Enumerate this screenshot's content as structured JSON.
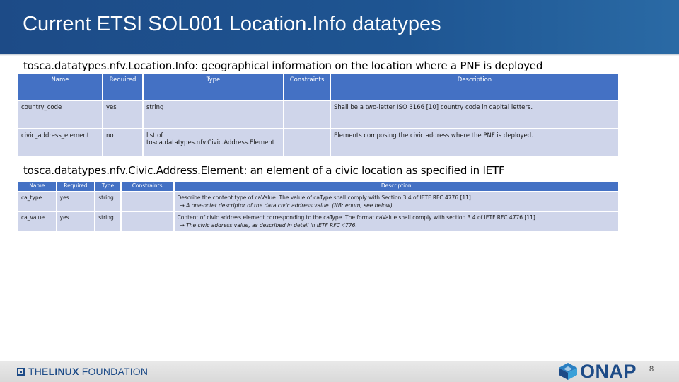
{
  "title": "Current ETSI SOL001 Location.Info datatypes",
  "section1": {
    "heading": "tosca.datatypes.nfv.Location.Info: geographical information on the location where a PNF is deployed",
    "columns": [
      "Name",
      "Required",
      "Type",
      "Constraints",
      "Description"
    ],
    "rows": [
      {
        "name": "country_code",
        "required": "yes",
        "type": "string",
        "constraints": "",
        "description": "Shall be a two-letter ISO 3166 [10] country code in capital letters."
      },
      {
        "name": "civic_address_element",
        "required": "no",
        "type": "list of tosca.datatypes.nfv.Civic.Address.Element",
        "constraints": "",
        "description": "Elements composing the civic address where the PNF is deployed."
      }
    ]
  },
  "section2": {
    "heading": "tosca.datatypes.nfv.Civic.Address.Element: an element of a civic location as specified in IETF",
    "columns": [
      "Name",
      "Required",
      "Type",
      "Constraints",
      "Description"
    ],
    "rows": [
      {
        "name": "ca_type",
        "required": "yes",
        "type": "string",
        "constraints": "",
        "description": "Describe the content type of caValue. The value of caType shall comply with Section 3.4 of IETF RFC 4776 [11].",
        "description_note": "→ A one-octet descriptor of the data civic address value. (NB: enum, see below)"
      },
      {
        "name": "ca_value",
        "required": "yes",
        "type": "string",
        "constraints": "",
        "description": "Content of civic address element corresponding to the caType. The format caValue shall comply with section 3.4 of IETF RFC 4776 [11]",
        "description_note": "→ The civic address value, as described in detail in IETF RFC 4776."
      }
    ]
  },
  "footer": {
    "foundation_the": "THE",
    "foundation_linux": "LINUX",
    "foundation_rest": " FOUNDATION",
    "onap_logo_text": "ONAP",
    "page_number": "8"
  },
  "colors": {
    "title_bar": "#1d4b87",
    "header_cell": "#4471c4",
    "body_cell": "#cfd5ea"
  }
}
